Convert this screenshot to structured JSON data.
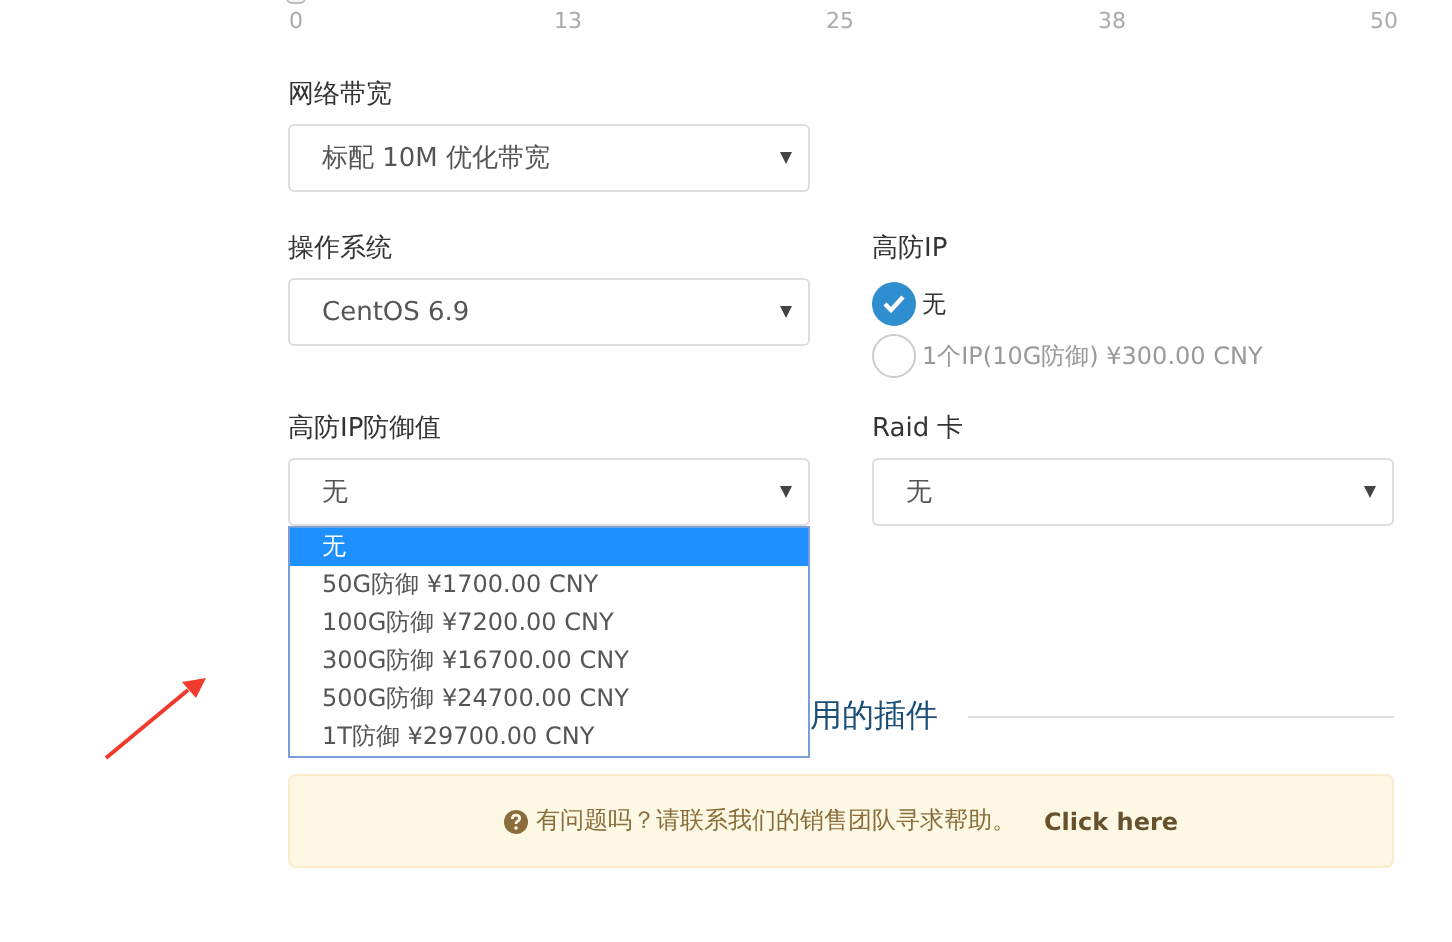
{
  "slider": {
    "ticks": [
      "0",
      "13",
      "25",
      "38",
      "50"
    ]
  },
  "bandwidth": {
    "label": "网络带宽",
    "value": "标配 10M 优化带宽"
  },
  "os": {
    "label": "操作系统",
    "value": "CentOS 6.9"
  },
  "ddos_ip": {
    "label": "高防IP",
    "options": [
      {
        "label": "无",
        "selected": true
      },
      {
        "label": "1个IP(10G防御) ¥300.00 CNY",
        "selected": false
      }
    ]
  },
  "ddos_level": {
    "label": "高防IP防御值",
    "value": "无",
    "expanded": true,
    "options": [
      {
        "label": "无",
        "selected": true
      },
      {
        "label": "50G防御 ¥1700.00 CNY",
        "selected": false
      },
      {
        "label": "100G防御 ¥7200.00 CNY",
        "selected": false
      },
      {
        "label": "300G防御 ¥16700.00 CNY",
        "selected": false
      },
      {
        "label": "500G防御 ¥24700.00 CNY",
        "selected": false
      },
      {
        "label": "1T防御 ¥29700.00 CNY",
        "selected": false
      }
    ]
  },
  "raid": {
    "label": "Raid 卡",
    "value": "无"
  },
  "addons_heading": "用的插件",
  "alert": {
    "text": "有问题吗？请联系我们的销售团队寻求帮助。",
    "link": "Click here"
  }
}
